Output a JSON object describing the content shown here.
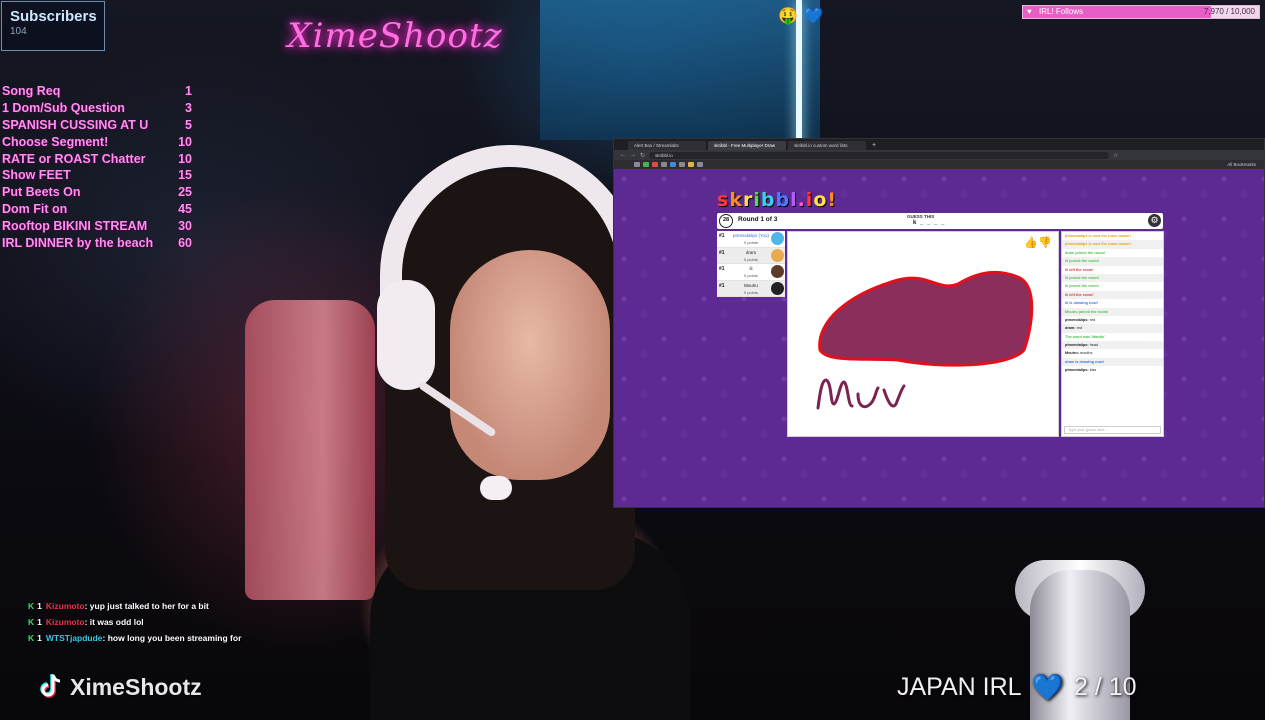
{
  "colors": {
    "accent_pink": "#ff8ef0",
    "follow_fill": "#e55fc7",
    "skribbl_bg": "#5d2a93",
    "drawing_fill": "#8a2e5c",
    "drawing_stroke": "#e2101d"
  },
  "stream": {
    "subscribers": {
      "title": "Subscribers",
      "count": "104"
    },
    "neon_sign": "XimeShootz",
    "floating_emojis": [
      "🤑",
      "💙"
    ],
    "redeem_menu": [
      {
        "label": "Song Req",
        "cost": "1"
      },
      {
        "label": "1 Dom/Sub Question",
        "cost": "3"
      },
      {
        "label": "SPANISH CUSSING AT U",
        "cost": "5"
      },
      {
        "label": "Choose Segment!",
        "cost": "10"
      },
      {
        "label": "RATE or ROAST Chatter",
        "cost": "10"
      },
      {
        "label": "Show FEET",
        "cost": "15"
      },
      {
        "label": "Put Beets On",
        "cost": "25"
      },
      {
        "label": "Dom Fit on",
        "cost": "45"
      },
      {
        "label": "Rooftop BIKINI STREAM",
        "cost": "30"
      },
      {
        "label": "IRL DINNER by the beach",
        "cost": "60"
      }
    ],
    "follow_goal": {
      "label": "IRL! Follows",
      "value": "7,970 / 10,000",
      "progress": 0.797
    },
    "chat": [
      {
        "badge": "K",
        "count": "1",
        "user": "Kizumoto",
        "user_color": "#e8344e",
        "text": ": yup just talked to her for a bit"
      },
      {
        "badge": "K",
        "count": "1",
        "user": "Kizumoto",
        "user_color": "#e8344e",
        "text": ": it was odd lol"
      },
      {
        "badge": "K",
        "count": "1",
        "user": "WTSTjapdude",
        "user_color": "#37c8e8",
        "text": ": how long you been streaming for"
      }
    ],
    "tiktok_name": "XimeShootz",
    "tiktok_icon": "tiktok-icon",
    "japan_goal": {
      "label": "JAPAN IRL",
      "heart": "💙",
      "progress_text": "2 / 10",
      "progress": 0.2
    }
  },
  "browser": {
    "tabs": [
      {
        "label": "Alert Box / Streamlabs",
        "active": false
      },
      {
        "label": "skribbl - Free Multiplayer Draw",
        "active": true
      },
      {
        "label": "skribbl.io custom word lists",
        "active": false
      }
    ],
    "new_tab": "+",
    "url": "skribbl.io",
    "bookmarks_right": "All Bookmarks"
  },
  "game": {
    "logo": "skribbl.io!",
    "timer": "28",
    "round_text": "Round 1 of 3",
    "guess_label": "GUESS THIS",
    "hint": "k _ _ _ _",
    "settings_icon": "gear-icon",
    "players": [
      {
        "rank": "#1",
        "name": "ptmendalips (You)",
        "points": "0 points",
        "self": true,
        "avatar_color": "#4fb6e8"
      },
      {
        "rank": "#1",
        "name": "dram",
        "points": "0 points",
        "self": false,
        "avatar_color": "#e8a94f"
      },
      {
        "rank": "#1",
        "name": "ili",
        "points": "0 points",
        "self": false,
        "avatar_color": "#5e3a2a"
      },
      {
        "rank": "#1",
        "name": "Mvutru",
        "points": "0 points",
        "self": false,
        "avatar_color": "#222222"
      }
    ],
    "chat": [
      {
        "cls": "gold",
        "text": "ptmendalips is now the room owner!"
      },
      {
        "cls": "gold",
        "text": "ptmendalips is now the room owner!"
      },
      {
        "cls": "green",
        "text": "dram joined the room!"
      },
      {
        "cls": "green",
        "text": "ili joined the room!"
      },
      {
        "cls": "red",
        "text": "ili left the room!"
      },
      {
        "cls": "green",
        "text": "ili joined the room!"
      },
      {
        "cls": "green",
        "text": "ili joined the room!"
      },
      {
        "cls": "red",
        "text": "ili left the room!"
      },
      {
        "cls": "blue",
        "text": "ili is drawing now!"
      },
      {
        "cls": "green",
        "text": "Mvutru joined the room!"
      },
      {
        "cls": "norm",
        "who": "ptmendalips:",
        "text": " red"
      },
      {
        "cls": "norm",
        "who": "dram:",
        "text": " red"
      },
      {
        "cls": "green",
        "text": "The word was 'Mantle'"
      },
      {
        "cls": "norm",
        "who": "ptmendalips:",
        "text": " head"
      },
      {
        "cls": "norm",
        "who": "Mvutru:",
        "text": " mouths"
      },
      {
        "cls": "blue",
        "text": "dram is drawing now!"
      },
      {
        "cls": "norm",
        "who": "ptmendalips:",
        "text": " kiss"
      }
    ],
    "chat_placeholder": "Type your guess here..."
  }
}
